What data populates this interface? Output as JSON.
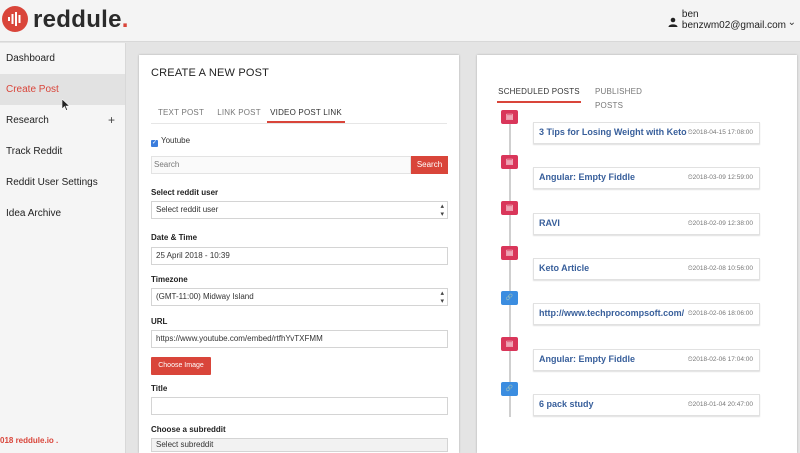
{
  "app": {
    "brand": "reddule",
    "brand_dot": ".",
    "accent": "#d9453a"
  },
  "user": {
    "name": "ben",
    "email": "benzwm02@gmail.com",
    "icon": "person-icon"
  },
  "sidebar": {
    "items": [
      {
        "label": "Dashboard"
      },
      {
        "label": "Create Post"
      },
      {
        "label": "Research",
        "expand": "+"
      },
      {
        "label": "Track Reddit"
      },
      {
        "label": "Reddit User Settings"
      },
      {
        "label": "Idea Archive"
      }
    ],
    "active_index": 1,
    "footer": "018 reddule.io ."
  },
  "create_post": {
    "title": "CREATE A NEW POST",
    "tabs": [
      "TEXT POST",
      "LINK POST",
      "VIDEO POST LINK"
    ],
    "active_tab": 2,
    "youtube_label": "Youtube",
    "youtube_checked": true,
    "search_placeholder": "Search",
    "search_button": "Search",
    "reddit_user_label": "Select reddit user",
    "reddit_user_value": "Select reddit user",
    "datetime_label": "Date & Time",
    "datetime_value": "25 April 2018 - 10:39",
    "timezone_label": "Timezone",
    "timezone_value": "(GMT-11:00) Midway Island",
    "url_label": "URL",
    "url_value": "https://www.youtube.com/embed/rtfhYvTXFMM",
    "choose_image": "Choose Image",
    "title_label": "Title",
    "title_value": "",
    "subreddit_label": "Choose a subreddit",
    "subreddit_value": "Select subreddit"
  },
  "schedule": {
    "tabs": [
      "SCHEDULED POSTS",
      "PUBLISHED POSTS"
    ],
    "active_tab": 0,
    "posts": [
      {
        "title": "3 Tips for Losing Weight with Keto",
        "date": "⏲2018-04-15 17:08:00",
        "kind": "doc"
      },
      {
        "title": "Angular: Empty Fiddle",
        "date": "⏲2018-03-09 12:59:00",
        "kind": "doc"
      },
      {
        "title": "RAVI",
        "date": "⏲2018-02-09 12:38:00",
        "kind": "doc"
      },
      {
        "title": "Keto Article",
        "date": "⏲2018-02-08 10:56:00",
        "kind": "doc"
      },
      {
        "title": "http://www.techprocompsoft.com/",
        "date": "⏲2018-02-06 18:06:00",
        "kind": "link"
      },
      {
        "title": "Angular: Empty Fiddle",
        "date": "⏲2018-02-06 17:04:00",
        "kind": "doc"
      },
      {
        "title": "6 pack study",
        "date": "⏲2018-01-04 20:47:00",
        "kind": "link"
      }
    ]
  }
}
